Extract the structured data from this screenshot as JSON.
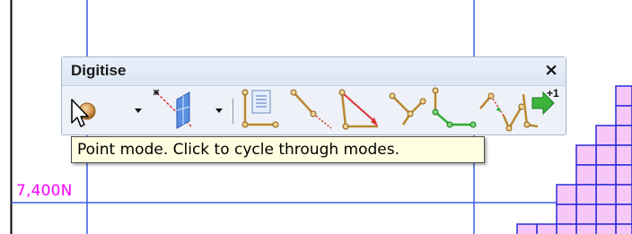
{
  "map": {
    "northing_label": "7,400N"
  },
  "toolbar": {
    "title": "Digitise",
    "close_symbol": "×",
    "tools": [
      {
        "icon": "point-mode-icon",
        "has_dropdown": true
      },
      {
        "icon": "snap-plane-icon",
        "has_dropdown": true
      },
      {
        "icon": "string-properties-icon"
      },
      {
        "icon": "digitise-line-icon"
      },
      {
        "icon": "digitise-closed-line-icon"
      },
      {
        "icon": "digitise-tee-icon"
      },
      {
        "icon": "digitise-green-string-icon"
      },
      {
        "icon": "digitise-join-icon"
      },
      {
        "icon": "increment-string-icon",
        "badge": "+1"
      }
    ]
  },
  "tooltip": {
    "text": "Point mode. Click to cycle through modes."
  },
  "colors": {
    "grid_line": "#3a5fe0",
    "label": "#ff00ff",
    "cell_fill": "#f7c8f7",
    "cell_border": "#2b2bd9",
    "string_line": "#8a5a1a",
    "vertex": "#c8a050"
  }
}
